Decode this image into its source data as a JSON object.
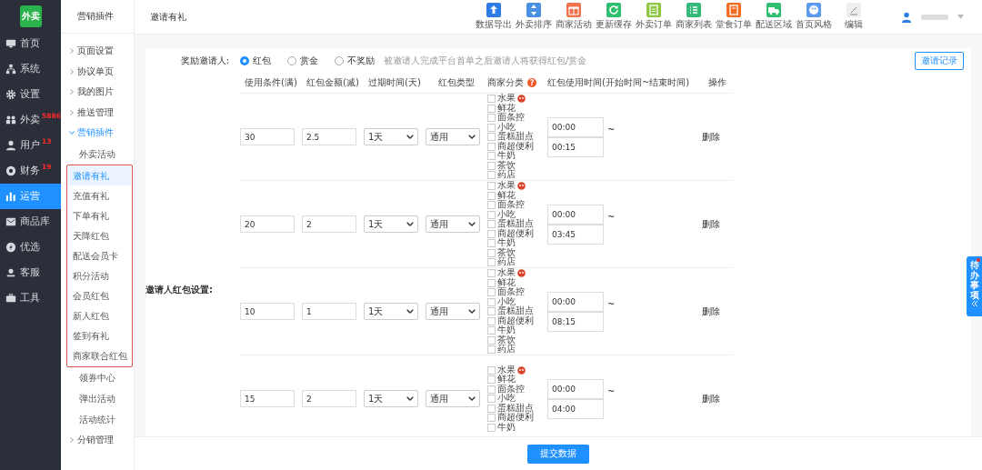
{
  "logo": {
    "text": "外卖"
  },
  "sidebar": {
    "items": [
      {
        "label": "首页",
        "selected": false
      },
      {
        "label": "系统",
        "selected": false
      },
      {
        "label": "设置",
        "selected": false
      },
      {
        "label": "外卖",
        "selected": false,
        "badge": "5886"
      },
      {
        "label": "用户",
        "selected": false,
        "badge": "13"
      },
      {
        "label": "财务",
        "selected": false,
        "badge": "19"
      },
      {
        "label": "运营",
        "selected": true
      },
      {
        "label": "商品库",
        "selected": false
      },
      {
        "label": "优选",
        "selected": false
      },
      {
        "label": "客服",
        "selected": false
      },
      {
        "label": "工具",
        "selected": false
      }
    ]
  },
  "submenu": {
    "title": "营销插件",
    "items": [
      {
        "label": "页面设置",
        "expanded": false
      },
      {
        "label": "协议单页",
        "expanded": false
      },
      {
        "label": "我的图片",
        "expanded": false
      },
      {
        "label": "推送管理",
        "expanded": false
      },
      {
        "label": "营销插件",
        "expanded": true,
        "children": [
          {
            "label": "外卖活动",
            "selected": false,
            "highlighted": false
          },
          {
            "label": "邀请有礼",
            "selected": true,
            "highlighted": true
          },
          {
            "label": "充值有礼",
            "selected": false,
            "highlighted": true
          },
          {
            "label": "下单有礼",
            "selected": false,
            "highlighted": true
          },
          {
            "label": "天降红包",
            "selected": false,
            "highlighted": true
          },
          {
            "label": "配送会员卡",
            "selected": false,
            "highlighted": true
          },
          {
            "label": "积分活动",
            "selected": false,
            "highlighted": true
          },
          {
            "label": "会员红包",
            "selected": false,
            "highlighted": true
          },
          {
            "label": "新人红包",
            "selected": false,
            "highlighted": true
          },
          {
            "label": "签到有礼",
            "selected": false,
            "highlighted": true
          },
          {
            "label": "商家联合红包",
            "selected": false,
            "highlighted": true
          },
          {
            "label": "领券中心",
            "selected": false,
            "highlighted": false
          },
          {
            "label": "弹出活动",
            "selected": false,
            "highlighted": false
          },
          {
            "label": "活动统计",
            "selected": false,
            "highlighted": false
          }
        ]
      },
      {
        "label": "分销管理",
        "expanded": false
      }
    ]
  },
  "header": {
    "title": "邀请有礼"
  },
  "toolbar": [
    {
      "label": "数据导出",
      "color": "#2d7be5"
    },
    {
      "label": "外卖排序",
      "color": "#4a90e2"
    },
    {
      "label": "商家活动",
      "color": "#f0734e"
    },
    {
      "label": "更新缓存",
      "color": "#2fbf71"
    },
    {
      "label": "外卖订单",
      "color": "#8dc63f"
    },
    {
      "label": "商家列表",
      "color": "#34b97b"
    },
    {
      "label": "堂食订单",
      "color": "#f36c21"
    },
    {
      "label": "配送区域",
      "color": "#2fbf71"
    },
    {
      "label": "首页风格",
      "color": "#5b9bf0"
    },
    {
      "label": "编辑",
      "color": "#eeeeee"
    }
  ],
  "reward": {
    "label": "奖励邀请人:",
    "options": [
      {
        "label": "红包",
        "selected": true
      },
      {
        "label": "赏金",
        "selected": false
      },
      {
        "label": "不奖励",
        "selected": false
      }
    ],
    "hint": "被邀请人完成平台首单之后邀请人将获得红包/赏金",
    "record_button": "邀请记录"
  },
  "table": {
    "label": "邀请人红包设置:",
    "columns": [
      {
        "label": "使用条件(满)"
      },
      {
        "label": "红包金额(减)"
      },
      {
        "label": "过期时间(天)"
      },
      {
        "label": "红包类型"
      },
      {
        "label": "商家分类",
        "help": "?"
      },
      {
        "label": "红包使用时间(开始时间~结束时间)"
      },
      {
        "label": "操作"
      }
    ],
    "rows": [
      {
        "min": "30",
        "amount": "2.5",
        "expire": "1天",
        "type": "通用",
        "start": "00:00",
        "separator": "~",
        "end": "00:15",
        "action": "删除",
        "categories": [
          {
            "label": "水果",
            "checked": false,
            "badge": true
          },
          {
            "label": "鲜花",
            "checked": false,
            "badge": false
          },
          {
            "label": "面条控",
            "checked": false,
            "badge": false
          },
          {
            "label": "小吃",
            "checked": false,
            "badge": false
          },
          {
            "label": "蛋糕甜点",
            "checked": false,
            "badge": false
          },
          {
            "label": "商超便利",
            "checked": false,
            "badge": false
          },
          {
            "label": "牛奶",
            "checked": false,
            "badge": false
          },
          {
            "label": "茶饮",
            "checked": false,
            "badge": false
          },
          {
            "label": "药店",
            "checked": false,
            "badge": false
          }
        ]
      },
      {
        "min": "20",
        "amount": "2",
        "expire": "1天",
        "type": "通用",
        "start": "00:00",
        "separator": "~",
        "end": "03:45",
        "action": "删除",
        "categories": [
          {
            "label": "水果",
            "checked": false,
            "badge": true
          },
          {
            "label": "鲜花",
            "checked": false,
            "badge": false
          },
          {
            "label": "面条控",
            "checked": false,
            "badge": false
          },
          {
            "label": "小吃",
            "checked": false,
            "badge": false
          },
          {
            "label": "蛋糕甜点",
            "checked": false,
            "badge": false
          },
          {
            "label": "商超便利",
            "checked": false,
            "badge": false
          },
          {
            "label": "牛奶",
            "checked": false,
            "badge": false
          },
          {
            "label": "茶饮",
            "checked": false,
            "badge": false
          },
          {
            "label": "药店",
            "checked": false,
            "badge": false
          }
        ]
      },
      {
        "min": "10",
        "amount": "1",
        "expire": "1天",
        "type": "通用",
        "start": "00:00",
        "separator": "~",
        "end": "08:15",
        "action": "删除",
        "categories": [
          {
            "label": "水果",
            "checked": false,
            "badge": true
          },
          {
            "label": "鲜花",
            "checked": false,
            "badge": false
          },
          {
            "label": "面条控",
            "checked": false,
            "badge": false
          },
          {
            "label": "小吃",
            "checked": false,
            "badge": false
          },
          {
            "label": "蛋糕甜点",
            "checked": false,
            "badge": false
          },
          {
            "label": "商超便利",
            "checked": false,
            "badge": false
          },
          {
            "label": "牛奶",
            "checked": false,
            "badge": false
          },
          {
            "label": "茶饮",
            "checked": false,
            "badge": false
          },
          {
            "label": "药店",
            "checked": false,
            "badge": false
          }
        ]
      },
      {
        "min": "15",
        "amount": "2",
        "expire": "1天",
        "type": "通用",
        "start": "00:00",
        "separator": "~",
        "end": "04:00",
        "action": "删除",
        "categories": [
          {
            "label": "水果",
            "checked": false,
            "badge": true
          },
          {
            "label": "鲜花",
            "checked": false,
            "badge": false
          },
          {
            "label": "面条控",
            "checked": false,
            "badge": false
          },
          {
            "label": "小吃",
            "checked": false,
            "badge": false
          },
          {
            "label": "蛋糕甜点",
            "checked": false,
            "badge": false
          },
          {
            "label": "商超便利",
            "checked": false,
            "badge": false
          },
          {
            "label": "牛奶",
            "checked": false,
            "badge": false
          }
        ]
      }
    ]
  },
  "submit_button": "提交数据",
  "todo_tab": {
    "label": "待办事项",
    "unread": true
  }
}
